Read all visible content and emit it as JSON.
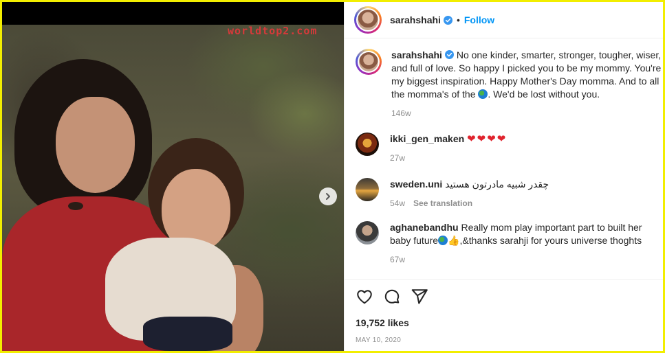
{
  "watermark": "worldtop2.com",
  "post": {
    "author": "sarahshahi",
    "follow_label": "Follow",
    "dot": "•",
    "caption": {
      "username": "sarahshahi",
      "text_before_globe": "No one kinder, smarter, stronger, tougher, wiser, and full of love. So happy I picked you to be my mommy. You're my biggest inspiration. Happy Mother's Day momma. And to all the momma's of the",
      "text_after_globe": ". We'd be lost without you.",
      "age": "146w"
    },
    "comments": [
      {
        "username": "ikki_gen_maken",
        "text": "❤❤❤❤",
        "age": "27w",
        "translate": ""
      },
      {
        "username": "sweden.uni",
        "text": "چقدر شبیه مادرتون هستید",
        "age": "54w",
        "translate": "See translation"
      },
      {
        "username": "aghanebandhu",
        "text_before": "Really mom play important part to built her baby future",
        "text_thumb": "👍",
        "text_after": ",&thanks sarahji for yours universe thoghts",
        "age": "67w",
        "translate": ""
      }
    ],
    "likes": "19,752 likes",
    "date": "MAY 10, 2020"
  },
  "icons": {
    "verified": "verified-badge-icon",
    "like": "heart-outline-icon",
    "comment": "comment-bubble-icon",
    "share": "paper-plane-icon",
    "next": "chevron-right-icon",
    "globe": "globe-emoji-icon"
  },
  "colors": {
    "border": "#f2ee00",
    "follow": "#0095f6",
    "verified": "#3897f0",
    "heart": "#e0242e",
    "meta": "#8e8e8e",
    "watermark": "#d63a3a"
  }
}
